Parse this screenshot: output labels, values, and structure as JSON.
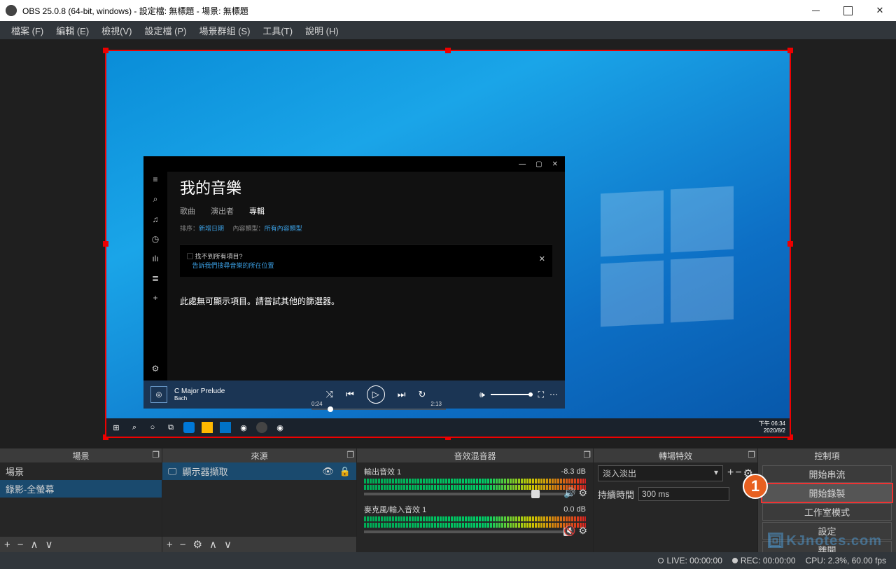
{
  "window": {
    "title": "OBS 25.0.8 (64-bit, windows) - 設定檔: 無標題 - 場景: 無標題"
  },
  "menubar": {
    "file": "檔案 (F)",
    "edit": "編輯 (E)",
    "view": "檢視(V)",
    "profile": "設定檔 (P)",
    "scene_collection": "場景群組 (S)",
    "tools": "工具(T)",
    "help": "說明 (H)"
  },
  "preview": {
    "music": {
      "header": "我的音樂",
      "tab_songs": "歌曲",
      "tab_artists": "演出者",
      "tab_albums": "專輯",
      "sort_label": "排序：",
      "sort_value": "新增日期",
      "genre_label": "內容類型：",
      "genre_value": "所有內容類型",
      "banner_q": "找不到所有項目?",
      "banner_link": "告訴我們搜尋音樂的所在位置",
      "empty_msg": "此處無可顯示項目。請嘗試其他的篩選器。",
      "track_title": "C Major Prelude",
      "track_artist": "Bach",
      "pos": "0:24",
      "dur": "2:13"
    },
    "clock_time": "下午 06:34",
    "clock_date": "2020/8/2"
  },
  "panels": {
    "scenes": {
      "title": "場景",
      "item1": "場景",
      "item2": "錄影-全螢幕"
    },
    "sources": {
      "title": "來源",
      "item1": "顯示器擷取"
    },
    "mixer": {
      "title": "音效混音器",
      "ch1": {
        "name": "輸出音效 1",
        "db": "-8.3 dB",
        "knob_pct": 82
      },
      "ch2": {
        "name": "麥克風/輸入音效 1",
        "db": "0.0 dB",
        "knob_pct": 100
      }
    },
    "transitions": {
      "title": "轉場特效",
      "selected": "淡入淡出",
      "duration_label": "持續時間",
      "duration_value": "300 ms"
    },
    "controls": {
      "title": "控制項",
      "start_stream": "開始串流",
      "start_record": "開始錄製",
      "studio_mode": "工作室模式",
      "settings": "設定",
      "exit": "離開"
    }
  },
  "statusbar": {
    "live": "LIVE: 00:00:00",
    "rec": "REC: 00:00:00",
    "cpu": "CPU: 2.3%, 60.00 fps"
  },
  "annotation": {
    "label": "1"
  },
  "watermark": "KJnotes.com"
}
